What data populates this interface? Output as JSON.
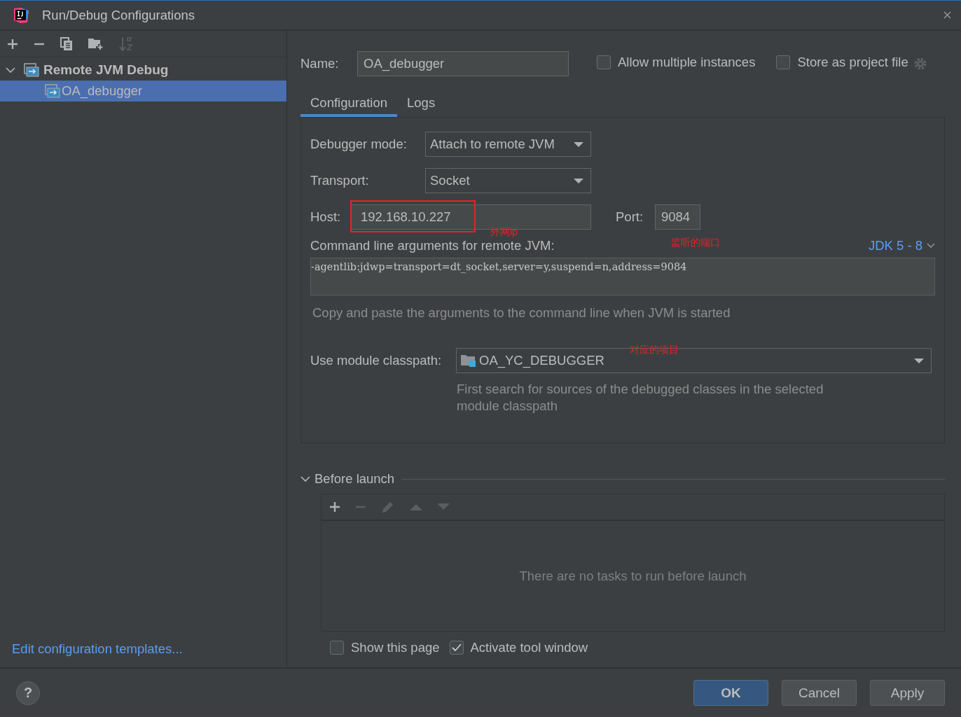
{
  "window": {
    "title": "Run/Debug Configurations"
  },
  "toolbar": [
    {
      "kind": "add",
      "disabled": false
    },
    {
      "kind": "remove",
      "disabled": false
    },
    {
      "kind": "copy",
      "disabled": false
    },
    {
      "kind": "folder",
      "disabled": false
    },
    {
      "kind": "sort",
      "disabled": true
    }
  ],
  "tree": [
    {
      "label": "Remote JVM Debug",
      "expanded": true,
      "selected": false,
      "children": [
        {
          "label": "OA_debugger",
          "selected": true
        }
      ]
    }
  ],
  "edit_templates_link": "Edit configuration templates...",
  "name_field": {
    "label": "Name:",
    "value": "OA_debugger"
  },
  "options": [
    {
      "label": "Allow multiple instances",
      "checked": false
    },
    {
      "label": "Store as project file",
      "checked": false
    }
  ],
  "tabs": [
    {
      "label": "Configuration",
      "selected": true
    },
    {
      "label": "Logs",
      "selected": false
    }
  ],
  "debugger_mode": {
    "label": "Debugger mode:",
    "value": "Attach to remote JVM"
  },
  "transport": {
    "label": "Transport:",
    "value": "Socket"
  },
  "host": {
    "label": "Host:",
    "value": "192.168.10.227"
  },
  "port": {
    "label": "Port:",
    "value": "9084"
  },
  "command_line": {
    "label": "Command line arguments for remote JVM:",
    "jdk": "JDK 5 - 8",
    "value": "-agentlib:jdwp=transport=dt_socket,server=y,suspend=n,address=9084",
    "hint": "Copy and paste the arguments to the command line when JVM is started"
  },
  "module_classpath": {
    "label": "Use module classpath:",
    "value": "OA_YC_DEBUGGER",
    "hint": "First search for sources of the debugged classes in the selected module classpath"
  },
  "annotations": [
    {
      "text": "外网ip"
    },
    {
      "text": "监听的端口"
    },
    {
      "text": "对应的项目"
    }
  ],
  "before_launch": {
    "title": "Before launch",
    "expanded": true,
    "empty_text": "There are no tasks to run before launch",
    "tools": [
      {
        "kind": "add",
        "disabled": false
      },
      {
        "kind": "remove",
        "disabled": true
      },
      {
        "kind": "edit",
        "disabled": true
      },
      {
        "kind": "up",
        "disabled": true
      },
      {
        "kind": "down",
        "disabled": true
      }
    ]
  },
  "launch_options": [
    {
      "label": "Show this page",
      "checked": false
    },
    {
      "label": "Activate tool window",
      "checked": true
    }
  ],
  "buttons": [
    {
      "label": "OK",
      "kind": "primary"
    },
    {
      "label": "Cancel",
      "kind": "default"
    },
    {
      "label": "Apply",
      "kind": "default"
    }
  ],
  "help_button": "?"
}
